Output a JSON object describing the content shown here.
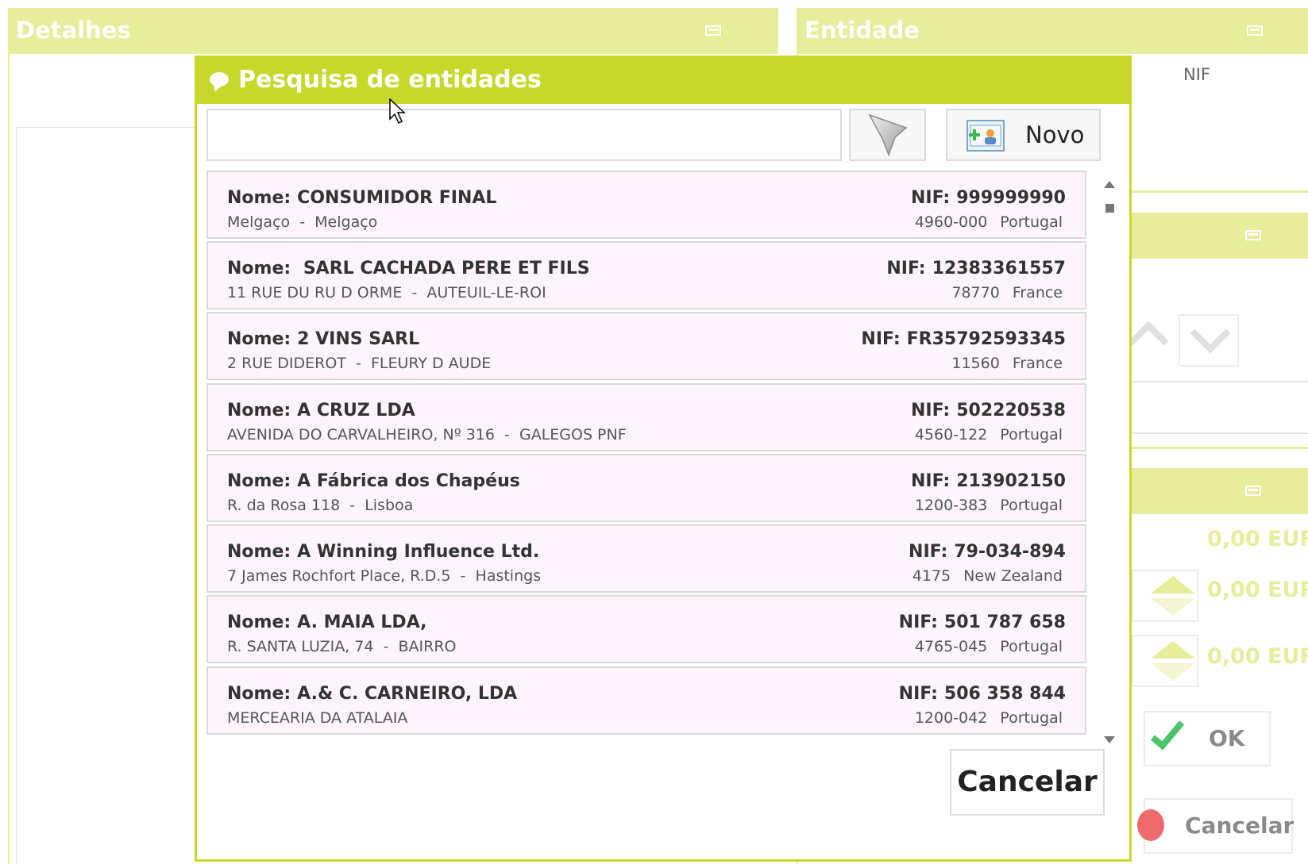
{
  "background": {
    "detalhes_title": "Detalhes",
    "entidade_title": "Entidade",
    "nif_label": "NIF",
    "amounts": [
      "0,00 EUR",
      "0,00 EUR",
      "0,00 EUR"
    ],
    "ok_label": "OK",
    "cancel_label": "Cancelar"
  },
  "modal": {
    "title": "Pesquisa de entidades",
    "search": {
      "value": "",
      "placeholder": ""
    },
    "new_label": "Novo",
    "cancel_label": "Cancelar",
    "name_prefix": "Nome:",
    "nif_prefix": "NIF:",
    "results": [
      {
        "name": "CONSUMIDOR FINAL",
        "address": "Melgaço",
        "city": "Melgaço",
        "nif": "999999990",
        "postal": "4960-000",
        "country": "Portugal"
      },
      {
        "name": " SARL CACHADA PERE ET FILS",
        "address": "11 RUE DU RU D ORME",
        "city": "AUTEUIL-LE-ROI",
        "nif": "12383361557",
        "postal": "78770",
        "country": "France"
      },
      {
        "name": "2 VINS SARL",
        "address": "2 RUE DIDEROT",
        "city": "FLEURY D AUDE",
        "nif": "FR35792593345",
        "postal": "11560",
        "country": "France"
      },
      {
        "name": "A CRUZ LDA",
        "address": "AVENIDA DO CARVALHEIRO, Nº 316",
        "city": "GALEGOS PNF",
        "nif": "502220538",
        "postal": "4560-122",
        "country": "Portugal"
      },
      {
        "name": "A Fábrica dos Chapéus",
        "address": "R. da Rosa 118",
        "city": "Lisboa",
        "nif": "213902150",
        "postal": "1200-383",
        "country": "Portugal"
      },
      {
        "name": "A Winning Influence Ltd.",
        "address": "7 James Rochfort Place, R.D.5",
        "city": "Hastings",
        "nif": "79-034-894",
        "postal": "4175",
        "country": "New Zealand"
      },
      {
        "name": "A. MAIA LDA,",
        "address": "R. SANTA LUZIA, 74",
        "city": "BAIRRO",
        "nif": "501 787 658",
        "postal": "4765-045",
        "country": "Portugal"
      },
      {
        "name": "A.& C. CARNEIRO, LDA",
        "address": "MERCEARIA DA ATALAIA",
        "city": "",
        "nif": "506 358 844",
        "postal": "1200-042",
        "country": "Portugal"
      }
    ]
  },
  "colors": {
    "accent": "#c6d92a",
    "accent_light": "#e6ed9b",
    "row_bg": "#fdf5fb"
  }
}
